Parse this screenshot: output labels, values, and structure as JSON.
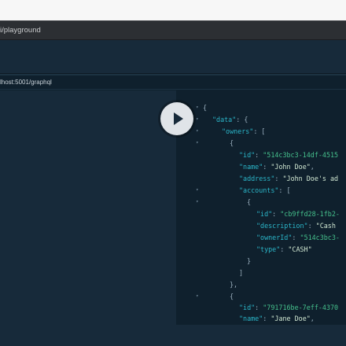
{
  "browser": {
    "url": "i/playground"
  },
  "playground": {
    "endpoint": "lhost:5001/graphql"
  },
  "run_button": {
    "icon": "play-icon"
  },
  "result": {
    "arrows": [
      "▾",
      "▾",
      "▾",
      "▾",
      "▾",
      "▾",
      "▾"
    ],
    "lines": [
      {
        "c": [
          [
            "p",
            "{"
          ]
        ]
      },
      {
        "c": [
          [
            "k",
            "\"data\""
          ],
          [
            "p",
            ": {"
          ]
        ]
      },
      {
        "c": [
          [
            "k",
            "\"owners\""
          ],
          [
            "p",
            ": ["
          ]
        ]
      },
      {
        "c": [
          [
            "p",
            "{"
          ]
        ]
      },
      {
        "c": [
          [
            "k",
            "\"id\""
          ],
          [
            "p",
            ": "
          ],
          [
            "sv",
            "\"514c3bc3-14df-4515"
          ]
        ]
      },
      {
        "c": [
          [
            "k",
            "\"name\""
          ],
          [
            "p",
            ": "
          ],
          [
            "s",
            "\"John Doe\""
          ],
          [
            "p",
            ","
          ]
        ]
      },
      {
        "c": [
          [
            "k",
            "\"address\""
          ],
          [
            "p",
            ": "
          ],
          [
            "s",
            "\"John Doe's ad"
          ]
        ]
      },
      {
        "c": [
          [
            "k",
            "\"accounts\""
          ],
          [
            "p",
            ": ["
          ]
        ]
      },
      {
        "c": [
          [
            "p",
            "{"
          ]
        ]
      },
      {
        "c": [
          [
            "k",
            "\"id\""
          ],
          [
            "p",
            ": "
          ],
          [
            "sv",
            "\"cb9ffd28-1fb2-"
          ]
        ]
      },
      {
        "c": [
          [
            "k",
            "\"description\""
          ],
          [
            "p",
            ": "
          ],
          [
            "s",
            "\"Cash "
          ]
        ]
      },
      {
        "c": [
          [
            "k",
            "\"ownerId\""
          ],
          [
            "p",
            ": "
          ],
          [
            "sv",
            "\"514c3bc3-"
          ]
        ]
      },
      {
        "c": [
          [
            "k",
            "\"type\""
          ],
          [
            "p",
            ": "
          ],
          [
            "s",
            "\"CASH\""
          ]
        ]
      },
      {
        "c": [
          [
            "p",
            "}"
          ]
        ]
      },
      {
        "c": [
          [
            "p",
            "]"
          ]
        ]
      },
      {
        "c": [
          [
            "p",
            "},"
          ]
        ]
      },
      {
        "c": [
          [
            "p",
            "{"
          ]
        ]
      },
      {
        "c": [
          [
            "k",
            "\"id\""
          ],
          [
            "p",
            ": "
          ],
          [
            "sv",
            "\"791716be-7eff-4370"
          ]
        ]
      },
      {
        "c": [
          [
            "k",
            "\"name\""
          ],
          [
            "p",
            ": "
          ],
          [
            "s",
            "\"Jane Doe\""
          ],
          [
            "p",
            ","
          ]
        ]
      },
      {
        "c": [
          [
            "k",
            "\"address\""
          ],
          [
            "p",
            ": "
          ],
          [
            "s",
            "\"Jane Doe's add"
          ]
        ]
      }
    ]
  }
}
